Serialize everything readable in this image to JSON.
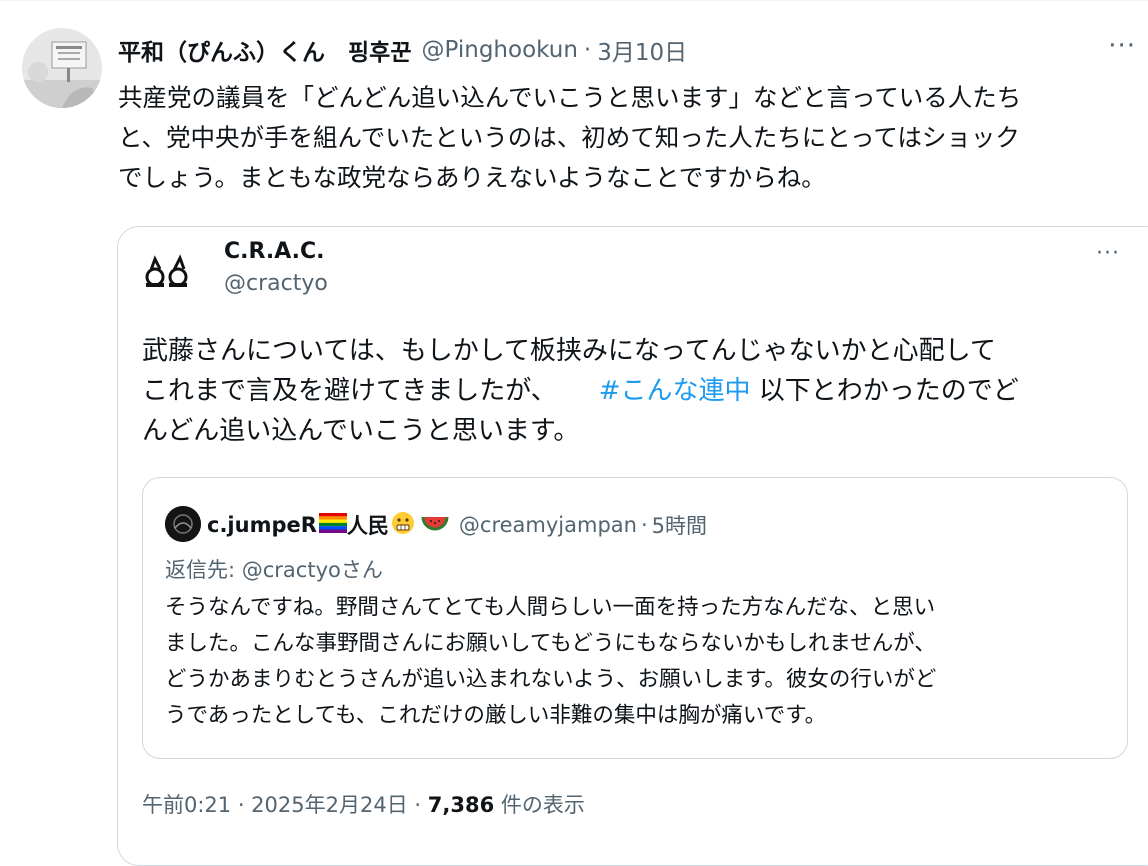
{
  "tweet": {
    "display_name": "平和（ぴんふ）くん　핑후꾼",
    "handle": "@Pinghookun",
    "separator": "·",
    "date": "3月10日",
    "more": "···",
    "text_lines": [
      "共産党の議員を「どんどん追い込んでいこうと思います」などと言っている人たち",
      "と、党中央が手を組んでいたというのは、初めて知った人たちにとってはショック",
      "でしょう。まともな政党ならありえないようなことですからね。"
    ]
  },
  "quoted": {
    "name": "C.R.A.C.",
    "handle": "@cractyo",
    "more": "···",
    "line1": "武藤さんについては、もしかして板挟みになってんじゃないかと心配して",
    "line2_prefix": "これまで言及を避けてきましたが、",
    "hashtag": "#こんな連中",
    "line2_suffix": " 以下とわかったのでど",
    "line3": "んどん追い込んでいこうと思います。",
    "footer_time": "午前0:21 · 2025年2月24日 · ",
    "views_count": "7,386",
    "views_label": " 件の表示",
    "nested": {
      "name": "c.jumpeR",
      "name_suffix": "人民",
      "handle": "@creamyjampan",
      "separator": "·",
      "time": "5時間",
      "reply_to": "返信先: @cractyoさん",
      "text_lines": [
        "そうなんですね。野間さんてとても人間らしい一面を持った方なんだな、と思い",
        "ました。こんな事野間さんにお願いしてもどうにもならないかもしれませんが、",
        "どうかあまりむとうさんが追い込まれないよう、お願いします。彼女の行いがど",
        "うであったとしても、これだけの厳しい非難の集中は胸が痛いです。"
      ]
    }
  },
  "colors": {
    "text": "#0f1419",
    "secondary": "#536471",
    "link": "#1d9bf0",
    "border": "#cfd9de"
  },
  "icons": [
    "more-icon",
    "crac-logo-icon",
    "rainbow-flag-icon",
    "grimace-emoji-icon",
    "watermelon-icon"
  ]
}
